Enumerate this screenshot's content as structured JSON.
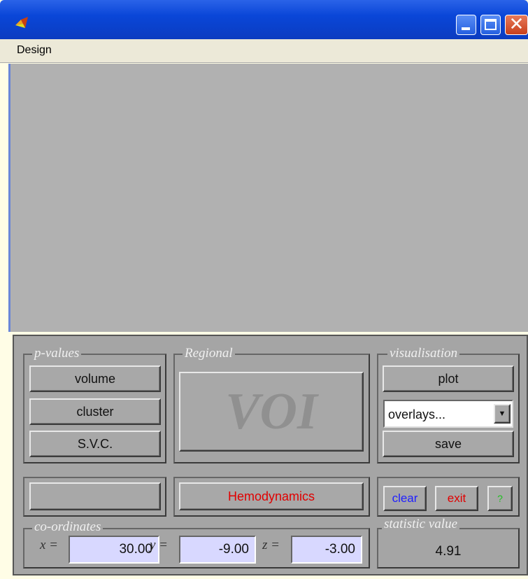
{
  "menu": {
    "design": "Design"
  },
  "panel": {
    "pvalues": {
      "legend": "p-values",
      "volume": "volume",
      "cluster": "cluster",
      "svc": "S.V.C."
    },
    "regional": {
      "legend": "Regional",
      "voi": "VOI"
    },
    "visualisation": {
      "legend": "visualisation",
      "plot": "plot",
      "overlays": "overlays...",
      "save": "save"
    },
    "hemodynamics": "Hemodynamics",
    "actions": {
      "clear": "clear",
      "exit": "exit",
      "help": "?"
    },
    "coordinates": {
      "legend": "co-ordinates",
      "x_label": "x =",
      "x": "30.00",
      "y_label": "y =",
      "y": "-9.00",
      "z_label": "z =",
      "z": "-3.00"
    },
    "statistic": {
      "legend": "statistic value",
      "value": "4.91"
    }
  },
  "colors": {
    "clear": "#2020ff",
    "exit": "#e00000",
    "help": "#20c020",
    "hemodynamics": "#e00000",
    "field_bg": "#d8d8ff",
    "panel_bg": "#a5a5a5",
    "figure_bg": "#b1b1b1"
  }
}
